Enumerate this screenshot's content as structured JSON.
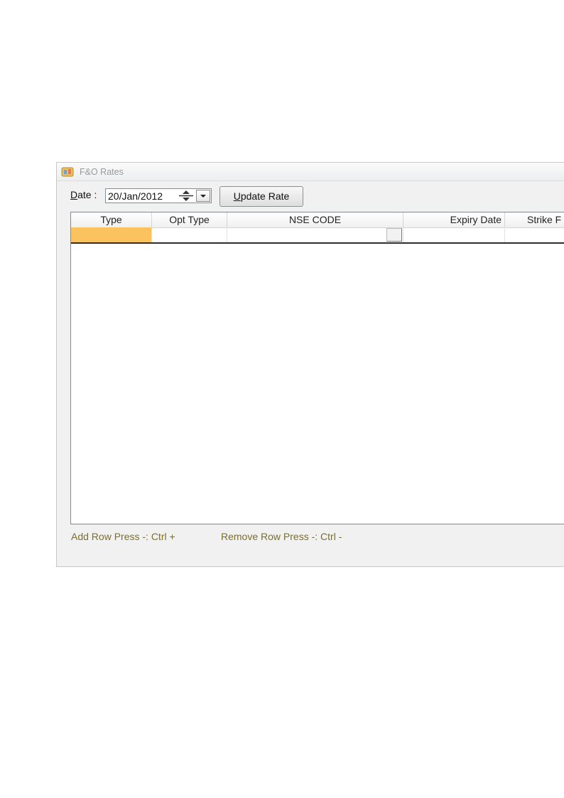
{
  "window": {
    "title": "F&O Rates"
  },
  "toolbar": {
    "date_label_underlined": "D",
    "date_label_rest": "ate :",
    "date_value": "20/Jan/2012",
    "update_button_underlined": "U",
    "update_button_rest": "pdate Rate"
  },
  "grid": {
    "columns": [
      "Type",
      "Opt Type",
      "NSE CODE",
      "Expiry Date",
      "Strike F"
    ]
  },
  "footer": {
    "add_row_hint": "Add Row Press -: Ctrl +",
    "remove_row_hint": "Remove Row Press -: Ctrl -"
  },
  "colors": {
    "active_cell": "#fbc360",
    "hint_text": "#7a6e2e"
  }
}
